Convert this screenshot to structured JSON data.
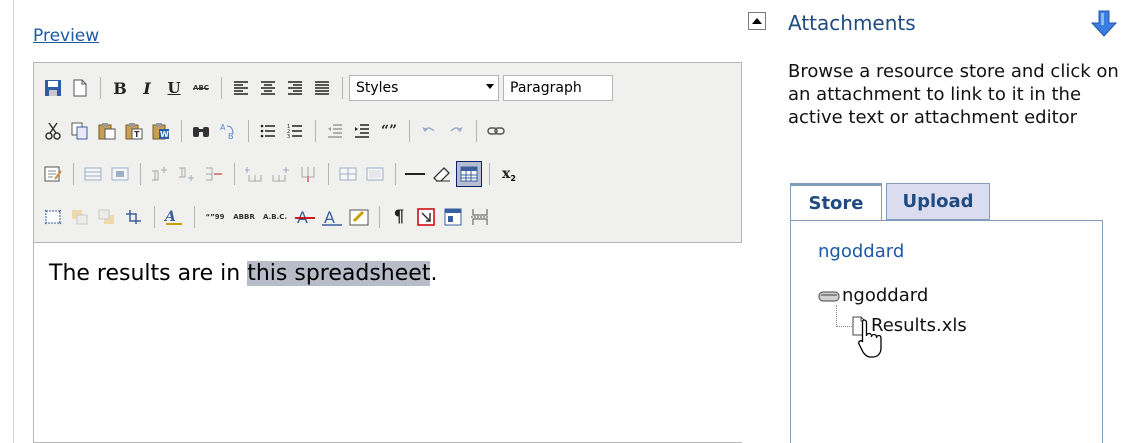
{
  "editor": {
    "preview_link": "Preview",
    "styles_select": "Styles",
    "format_select": "Paragraph",
    "content_before": "The results are in ",
    "content_selected": "this spreadsheet",
    "content_after": ".",
    "toolbar_text": {
      "bold": "B",
      "italic": "I",
      "underline": "U",
      "strikethrough": "ABC",
      "quote": "“”",
      "cite": "“”99",
      "abbr": "ABBR",
      "acronym": "A.B.C.",
      "pilcrow": "¶",
      "subscript": "x",
      "sub_mark": "2"
    }
  },
  "attachments": {
    "title": "Attachments",
    "description": "Browse a resource store and click on an attachment to link to it in the active text or attachment editor",
    "tabs": {
      "store": "Store",
      "upload": "Upload"
    },
    "store_user": "ngoddard",
    "tree_root": "ngoddard",
    "tree_file": "Results.xls"
  },
  "colors": {
    "link": "#1c5aa6",
    "title": "#1f4b80",
    "selection": "#b8bcc8",
    "tab_inactive": "#dcdcf0",
    "toolbar_bg": "#f0f0ee"
  }
}
